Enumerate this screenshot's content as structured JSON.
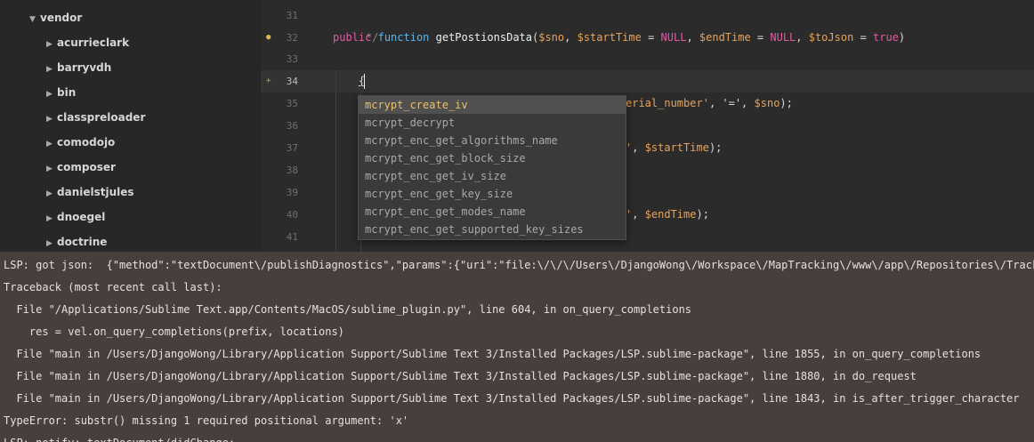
{
  "sidebar": {
    "root": "vendor",
    "items": [
      "acurrieclark",
      "barryvdh",
      "bin",
      "classpreloader",
      "comodojo",
      "composer",
      "danielstjules",
      "dnoegel",
      "doctrine"
    ]
  },
  "editor": {
    "line_numbers": [
      "31",
      "32",
      "33",
      "34",
      "35",
      "36",
      "37",
      "38",
      "39",
      "40",
      "41"
    ],
    "lines": {
      "l31": "*/",
      "l32": {
        "public": "public",
        "function": "function",
        "name": "getPostionsData",
        "open": "(",
        "p1": "$sno",
        "c1": ", ",
        "p2": "$startTime",
        "eq2": " = ",
        "v2": "NULL",
        "c2": ", ",
        "p3": "$endTime",
        "eq3": " = ",
        "v3": "NULL",
        "c3": ", ",
        "p4": "$toJson",
        "eq4": " = ",
        "v4": "true",
        "close": ")"
      },
      "l33": "{",
      "l34": "$",
      "l35": {
        "str": "erial_number",
        "q": "'",
        "mid": ", '=', ",
        "var": "$sno",
        "end": ");"
      },
      "l37": {
        "q": "'",
        "mid": ", ",
        "var": "$startTime",
        "end": ");"
      },
      "l40": {
        "q": "'",
        "mid": ", ",
        "var": "$endTime",
        "end": ");"
      },
      "l41": "}"
    }
  },
  "autocomplete": {
    "items": [
      "mcrypt_create_iv",
      "mcrypt_decrypt",
      "mcrypt_enc_get_algorithms_name",
      "mcrypt_enc_get_block_size",
      "mcrypt_enc_get_iv_size",
      "mcrypt_enc_get_key_size",
      "mcrypt_enc_get_modes_name",
      "mcrypt_enc_get_supported_key_sizes"
    ]
  },
  "console": {
    "lines": [
      "LSP: got json:  {\"method\":\"textDocument\\/publishDiagnostics\",\"params\":{\"uri\":\"file:\\/\\/\\/Users\\/DjangoWong\\/Workspace\\/MapTracking\\/www\\/app\\/Repositories\\/TrackingRe",
      "Traceback (most recent call last):",
      "  File \"/Applications/Sublime Text.app/Contents/MacOS/sublime_plugin.py\", line 604, in on_query_completions",
      "    res = vel.on_query_completions(prefix, locations)",
      "  File \"main in /Users/DjangoWong/Library/Application Support/Sublime Text 3/Installed Packages/LSP.sublime-package\", line 1855, in on_query_completions",
      "  File \"main in /Users/DjangoWong/Library/Application Support/Sublime Text 3/Installed Packages/LSP.sublime-package\", line 1880, in do_request",
      "  File \"main in /Users/DjangoWong/Library/Application Support/Sublime Text 3/Installed Packages/LSP.sublime-package\", line 1843, in is_after_trigger_character",
      "TypeError: substr() missing 1 required positional argument: 'x'",
      "LSP: notify: textDocument/didChange:"
    ]
  },
  "colors": {
    "sidebar_bg": "#272727",
    "editor_bg": "#2b2b2b",
    "console_bg": "#473f3c",
    "selection_text": "#e8c170",
    "modified_marker": "#e0b64a",
    "added_marker": "#8fbf5a"
  }
}
